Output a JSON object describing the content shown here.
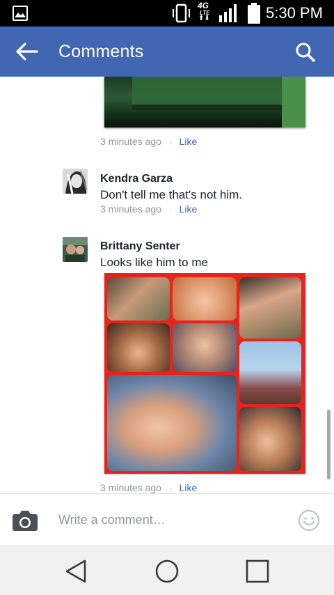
{
  "status_bar": {
    "network_label": "4G",
    "network_sub": "LTE",
    "time": "5:30 PM",
    "icons": [
      "gallery-icon",
      "vibrate-icon",
      "signal-icon",
      "battery-icon"
    ]
  },
  "app_bar": {
    "title": "Comments",
    "icons": [
      "back-arrow-icon",
      "search-icon"
    ],
    "color": "#4267b2"
  },
  "comments": [
    {
      "time": "3 minutes ago",
      "separator": "·",
      "like_label": "Like",
      "has_image": true
    },
    {
      "author": "Kendra Garza",
      "text": "Don't tell me that's not him.",
      "time": "3 minutes ago",
      "separator": "·",
      "like_label": "Like"
    },
    {
      "author": "Brittany Senter",
      "text": "Looks like him to me",
      "time": "3 minutes ago",
      "separator": "·",
      "like_label": "Like",
      "has_image": true
    }
  ],
  "composer": {
    "placeholder": "Write a comment…",
    "value": "",
    "icons": [
      "camera-icon",
      "emoji-icon"
    ]
  },
  "nav_bar": {
    "icons": [
      "back-triangle-icon",
      "home-circle-icon",
      "recents-square-icon"
    ]
  },
  "colors": {
    "accent": "#4267b2",
    "meta_text": "#90949c",
    "collage_border": "#e8231c"
  }
}
